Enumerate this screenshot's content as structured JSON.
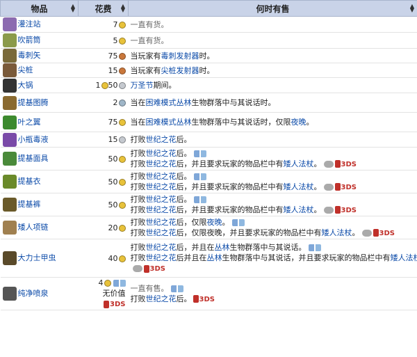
{
  "header": {
    "item": "物品",
    "cost": "花费",
    "when": "何时有售"
  },
  "rows": [
    {
      "name": "灌注站",
      "cost": "7",
      "coin": "gold",
      "icon": "imbuing-station-icon",
      "color": "#8c6bb0",
      "lines": [
        [
          {
            "t": "一直有货。",
            "c": "muted"
          }
        ]
      ]
    },
    {
      "name": "吹箭筒",
      "cost": "5",
      "coin": "gold",
      "icon": "blowgun-icon",
      "color": "#8b9a4a",
      "lines": [
        [
          {
            "t": "一直有货。",
            "c": "muted"
          }
        ]
      ]
    },
    {
      "name": "毒刺矢",
      "cost": "75",
      "coin": "copper",
      "icon": "poison-dart-icon",
      "color": "#7a6a3a",
      "lines": [
        [
          {
            "t": "当玩家有"
          },
          {
            "t": "毒刺发射器",
            "c": "link"
          },
          {
            "t": "时。"
          }
        ]
      ]
    },
    {
      "name": "尖桩",
      "cost": "15",
      "coin": "copper",
      "icon": "stake-icon",
      "color": "#7a5a3a",
      "lines": [
        [
          {
            "t": "当玩家有"
          },
          {
            "t": "尖桩发射器",
            "c": "link"
          },
          {
            "t": "时。"
          }
        ]
      ]
    },
    {
      "name": "大锅",
      "cost": "1",
      "cost2": "50",
      "coin": "gold",
      "coin2": "silver",
      "icon": "cauldron-icon",
      "color": "#333",
      "lines": [
        [
          {
            "t": "万圣节",
            "c": "link"
          },
          {
            "t": "期间。"
          }
        ]
      ]
    },
    {
      "name": "提基图腾",
      "cost": "2",
      "coin": "plat",
      "icon": "tiki-totem-icon",
      "color": "#8a6a30",
      "lines": [
        [
          {
            "t": "当在"
          },
          {
            "t": "困难模式丛林",
            "c": "link"
          },
          {
            "t": "生物群落中与其说话时。"
          }
        ]
      ]
    },
    {
      "name": "叶之翼",
      "cost": "75",
      "coin": "gold",
      "icon": "leaf-wings-icon",
      "color": "#3c8a2e",
      "lines": [
        [
          {
            "t": "当在"
          },
          {
            "t": "困难模式丛林",
            "c": "link"
          },
          {
            "t": "生物群落中与其说话时，仅限"
          },
          {
            "t": "夜晚",
            "c": "link"
          },
          {
            "t": "。"
          }
        ]
      ]
    },
    {
      "name": "小瓶毒液",
      "cost": "15",
      "coin": "silver",
      "icon": "vial-of-venom-icon",
      "color": "#7a4aa8",
      "lines": [
        [
          {
            "t": "打败"
          },
          {
            "t": "世纪之花",
            "c": "link"
          },
          {
            "t": "后。"
          }
        ]
      ]
    },
    {
      "name": "提基面具",
      "cost": "50",
      "coin": "gold",
      "icon": "tiki-mask-icon",
      "color": "#4a8a3a",
      "lines": [
        [
          {
            "t": "打败"
          },
          {
            "t": "世纪之花",
            "c": "link"
          },
          {
            "t": "后。"
          },
          {
            "p": "pc"
          }
        ],
        [
          {
            "t": "打败"
          },
          {
            "t": "世纪之花",
            "c": "link"
          },
          {
            "t": "后，并且要求玩家的物品栏中有"
          },
          {
            "t": "矮人法杖",
            "c": "link"
          },
          {
            "t": "。"
          },
          {
            "p": "ctrl"
          },
          {
            "p": "ds"
          }
        ]
      ]
    },
    {
      "name": "提基衣",
      "cost": "50",
      "coin": "gold",
      "icon": "tiki-shirt-icon",
      "color": "#6a8a2a",
      "lines": [
        [
          {
            "t": "打败"
          },
          {
            "t": "世纪之花",
            "c": "link"
          },
          {
            "t": "后。"
          },
          {
            "p": "pc"
          }
        ],
        [
          {
            "t": "打败"
          },
          {
            "t": "世纪之花",
            "c": "link"
          },
          {
            "t": "后，并且要求玩家的物品栏中有"
          },
          {
            "t": "矮人法杖",
            "c": "link"
          },
          {
            "t": "。"
          },
          {
            "p": "ctrl"
          },
          {
            "p": "ds"
          }
        ]
      ]
    },
    {
      "name": "提基裤",
      "cost": "50",
      "coin": "gold",
      "icon": "tiki-pants-icon",
      "color": "#6a5a2a",
      "lines": [
        [
          {
            "t": "打败"
          },
          {
            "t": "世纪之花",
            "c": "link"
          },
          {
            "t": "后。"
          },
          {
            "p": "pc"
          }
        ],
        [
          {
            "t": "打败"
          },
          {
            "t": "世纪之花",
            "c": "link"
          },
          {
            "t": "后，并且要求玩家的物品栏中有"
          },
          {
            "t": "矮人法杖",
            "c": "link"
          },
          {
            "t": "。"
          },
          {
            "p": "ctrl"
          },
          {
            "p": "ds"
          }
        ]
      ]
    },
    {
      "name": "矮人项链",
      "cost": "20",
      "coin": "gold",
      "icon": "pygmy-necklace-icon",
      "color": "#a08050",
      "lines": [
        [
          {
            "t": "打败"
          },
          {
            "t": "世纪之花",
            "c": "link"
          },
          {
            "t": "后，仅限"
          },
          {
            "t": "夜晚",
            "c": "link"
          },
          {
            "t": "。"
          },
          {
            "p": "pc"
          }
        ],
        [
          {
            "t": "打败"
          },
          {
            "t": "世纪之花",
            "c": "link"
          },
          {
            "t": "后，仅限夜晚，并且要求玩家的物品栏中有"
          },
          {
            "t": "矮人法杖",
            "c": "link"
          },
          {
            "t": "。"
          },
          {
            "p": "ctrl"
          },
          {
            "p": "ds"
          }
        ]
      ]
    },
    {
      "name": "大力士甲虫",
      "cost": "40",
      "coin": "gold",
      "icon": "hercules-beetle-icon",
      "color": "#5a4a2a",
      "lines": [
        [
          {
            "t": "打败"
          },
          {
            "t": "世纪之花",
            "c": "link"
          },
          {
            "t": "后，并且在"
          },
          {
            "t": "丛林",
            "c": "link"
          },
          {
            "t": "生物群落中与其说话。"
          },
          {
            "p": "pc"
          }
        ],
        [
          {
            "t": "打败"
          },
          {
            "t": "世纪之花",
            "c": "link"
          },
          {
            "t": "后并且在"
          },
          {
            "t": "丛林",
            "c": "link"
          },
          {
            "t": "生物群落中与其说话，并且要求玩家的物品栏中有"
          },
          {
            "t": "矮人法杖",
            "c": "link"
          },
          {
            "t": "。"
          }
        ],
        [
          {
            "p": "ctrl"
          },
          {
            "p": "ds"
          }
        ]
      ]
    },
    {
      "name": "纯净喷泉",
      "cost": "4",
      "coin": "gold",
      "costNote": "无价值",
      "icon": "pure-water-fountain-icon",
      "color": "#555",
      "lines": [
        [
          {
            "t": "一直有售。",
            "c": "muted"
          },
          {
            "p": "pc"
          }
        ],
        [
          {
            "t": "打败"
          },
          {
            "t": "世纪之花",
            "c": "link"
          },
          {
            "t": "后。"
          },
          {
            "p": "ds"
          }
        ]
      ]
    }
  ],
  "labels": {
    "ds": "3DS"
  }
}
